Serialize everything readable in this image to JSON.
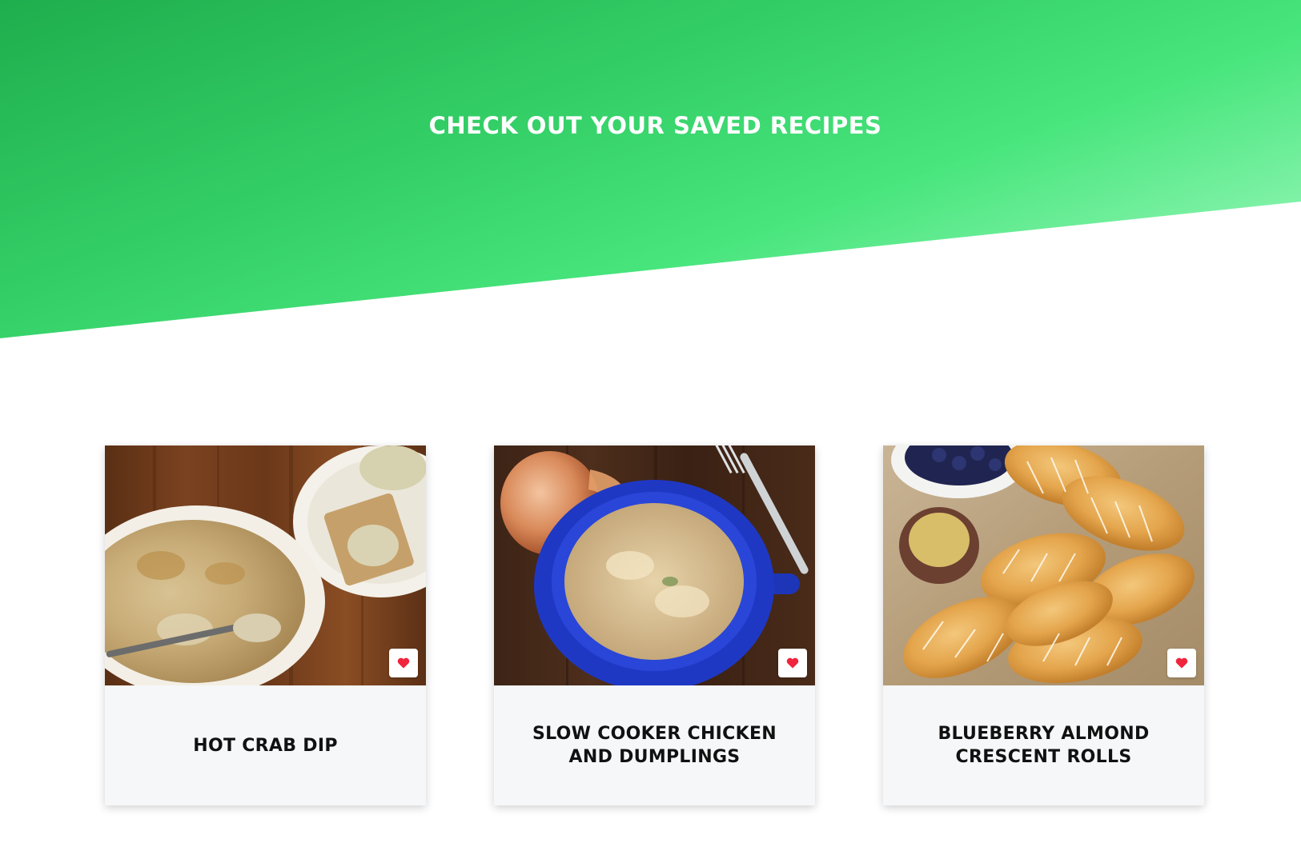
{
  "hero": {
    "title": "CHECK OUT YOUR SAVED RECIPES"
  },
  "colors": {
    "hero_gradient_start": "#1fae4d",
    "hero_gradient_end": "#aefcca",
    "heart": "#f0243d",
    "card_footer_bg": "#f5f7f9"
  },
  "recipes": [
    {
      "title": "HOT CRAB DIP",
      "favorite_icon": "heart-icon"
    },
    {
      "title": "SLOW COOKER CHICKEN AND DUMPLINGS",
      "favorite_icon": "heart-icon"
    },
    {
      "title": "BLUEBERRY ALMOND CRESCENT ROLLS",
      "favorite_icon": "heart-icon"
    }
  ]
}
